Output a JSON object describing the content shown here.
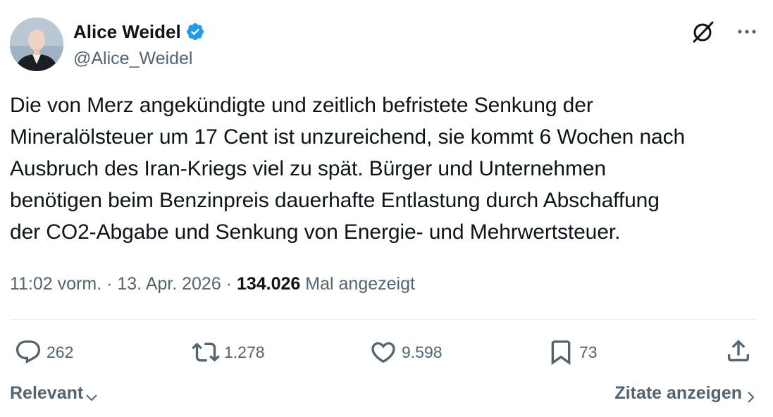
{
  "author": {
    "display_name": "Alice Weidel",
    "handle": "@Alice_Weidel",
    "verified": true,
    "verified_color": "#1d9bf0"
  },
  "tweet": {
    "lines": [
      "Die von Merz angekündigte und zeitlich befristete Senkung der",
      "Mineralölsteuer um 17 Cent ist unzureichend, sie kommt 6 Wochen nach",
      "Ausbruch des Iran-Kriegs viel zu spät. Bürger und Unternehmen",
      "benötigen beim Benzinpreis dauerhafte Entlastung durch Abschaffung",
      "der CO2-Abgabe und Senkung von Energie- und Mehrwertsteuer."
    ]
  },
  "meta": {
    "time": "11:02 vorm.",
    "separator": " · ",
    "date": "13. Apr. 2026",
    "views_count": "134.026",
    "views_label": "Mal angezeigt"
  },
  "actions": {
    "replies": "262",
    "retweets": "1.278",
    "likes": "9.598",
    "bookmarks": "73"
  },
  "footer": {
    "sort_label": "Relevant",
    "quotes_label": "Zitate anzeigen"
  },
  "icons": {
    "verified": "verified-badge-icon",
    "grok": "grok-icon",
    "more": "more-icon",
    "reply": "reply-icon",
    "retweet": "retweet-icon",
    "like": "heart-icon",
    "bookmark": "bookmark-icon",
    "share": "share-icon"
  },
  "colors": {
    "text_primary": "#0f1419",
    "text_secondary": "#536471",
    "divider": "#eff3f4"
  }
}
